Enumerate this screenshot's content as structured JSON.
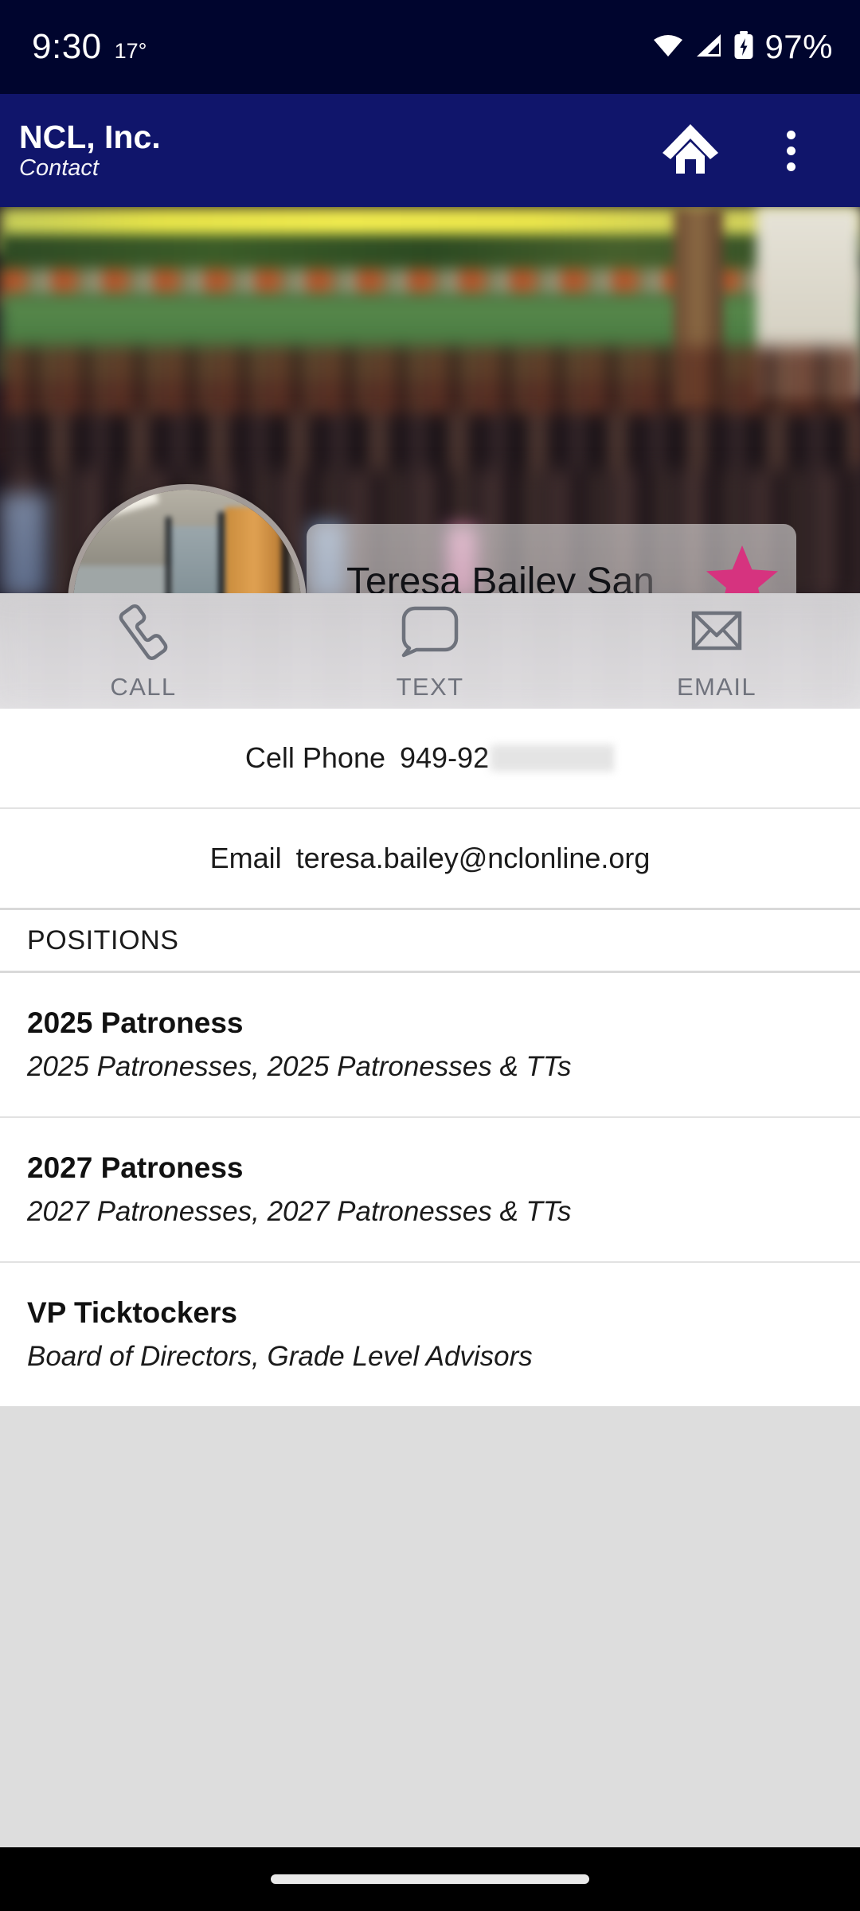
{
  "status_bar": {
    "time": "9:30",
    "temperature": "17°",
    "battery_percent": "97%",
    "icons": [
      "wifi-icon",
      "cellular-signal-icon",
      "battery-charging-icon"
    ]
  },
  "app_bar": {
    "title": "NCL, Inc.",
    "subtitle": "Contact",
    "home_icon": "home-icon",
    "overflow_icon": "overflow-menu-icon"
  },
  "profile": {
    "name": "Teresa Bailey San",
    "avatar": "contact-avatar-photo",
    "favorite_icon": "star-icon",
    "favorite_color": "#d6337f",
    "banner": "organization-group-photo"
  },
  "actions": [
    {
      "label": "CALL",
      "icon": "phone-icon"
    },
    {
      "label": "TEXT",
      "icon": "message-bubble-icon"
    },
    {
      "label": "EMAIL",
      "icon": "envelope-icon"
    }
  ],
  "fields": [
    {
      "label": "Cell Phone",
      "value": "949-92",
      "redacted": true
    },
    {
      "label": "Email",
      "value": "teresa.bailey@nclonline.org",
      "redacted": false
    }
  ],
  "positions_section": {
    "header": "POSITIONS",
    "items": [
      {
        "title": "2025 Patroness",
        "subtitle": "2025 Patronesses, 2025 Patronesses & TTs"
      },
      {
        "title": "2027 Patroness",
        "subtitle": "2027 Patronesses, 2027 Patronesses & TTs"
      },
      {
        "title": "VP Ticktockers",
        "subtitle": "Board of Directors, Grade Level Advisors"
      }
    ]
  },
  "nav_bar": {
    "handle": "gesture-navigation-handle"
  },
  "colors": {
    "status_bar_bg": "#00052e",
    "app_bar_bg": "#10156b",
    "accent_star": "#d6337f",
    "page_bg": "#dddddd",
    "content_bg": "#ffffff",
    "icon_gray": "#70737d"
  }
}
